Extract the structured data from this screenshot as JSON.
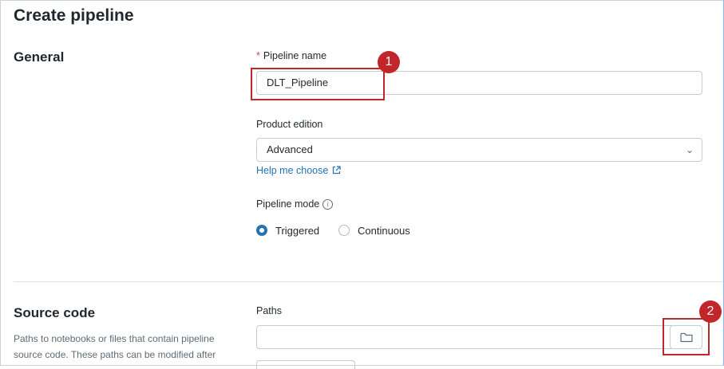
{
  "page": {
    "title": "Create pipeline"
  },
  "general": {
    "title": "General",
    "pipeline_name": {
      "required_mark": "*",
      "label": "Pipeline name",
      "value": "DLT_Pipeline"
    },
    "product_edition": {
      "label": "Product edition",
      "value": "Advanced"
    },
    "help_link": "Help me choose",
    "pipeline_mode": {
      "label": "Pipeline mode",
      "selected": "Triggered",
      "options": [
        "Triggered",
        "Continuous"
      ]
    }
  },
  "source_code": {
    "title": "Source code",
    "description": "Paths to notebooks or files that contain pipeline source code. These paths can be modified after",
    "paths": {
      "label": "Paths",
      "value": ""
    }
  },
  "annotations": {
    "badge_1": "1",
    "badge_2": "2"
  },
  "colors": {
    "accent": "#2272b4",
    "annotation": "#c0262a",
    "required": "#e04050"
  },
  "icons": [
    "external-link-icon",
    "info-icon",
    "chevron-down-icon",
    "folder-icon"
  ]
}
